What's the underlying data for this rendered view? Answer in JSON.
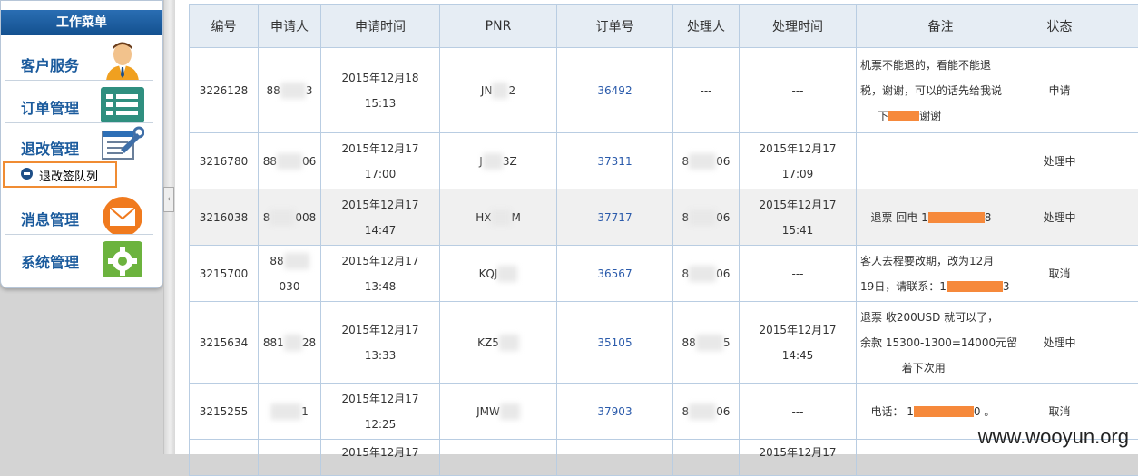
{
  "sidebar": {
    "title": "工作菜单",
    "items": [
      {
        "label": "客户服务",
        "icon": "customer-service-icon"
      },
      {
        "label": "订单管理",
        "icon": "order-list-icon"
      },
      {
        "label": "退改管理",
        "icon": "refund-tools-icon"
      },
      {
        "label": "消息管理",
        "icon": "mail-icon"
      },
      {
        "label": "系统管理",
        "icon": "settings-gear-icon"
      }
    ],
    "active_sub": {
      "label": "退改签队列",
      "icon": "minus-circle-icon"
    }
  },
  "splitter": {
    "glyph": "‹"
  },
  "table": {
    "headers": [
      "编号",
      "申请人",
      "申请时间",
      "PNR",
      "订单号",
      "处理人",
      "处理时间",
      "备注",
      "状态"
    ],
    "rows": [
      {
        "id": "3226128",
        "applicant_a": "88",
        "applicant_b": "3",
        "apply_time": [
          "2015年12月18",
          "15:13"
        ],
        "pnr_a": "JN",
        "pnr_b": "2",
        "order": "36492",
        "handler": "---",
        "handle_time": [
          "---"
        ],
        "remark": [
          "机票不能退的，看能不能退",
          "税，谢谢，可以的话先给我说",
          "下",
          "谢谢"
        ],
        "status": "申请"
      },
      {
        "id": "3216780",
        "applicant_a": "88",
        "applicant_b": "06",
        "apply_time": [
          "2015年12月17",
          "17:00"
        ],
        "pnr_a": "J",
        "pnr_b": "3Z",
        "order": "37311",
        "handler_a": "8",
        "handler_b": "06",
        "handle_time": [
          "2015年12月17",
          "17:09"
        ],
        "remark": [],
        "status": "处理中"
      },
      {
        "id": "3216038",
        "applicant_a": "8",
        "applicant_b": "008",
        "apply_time": [
          "2015年12月17",
          "14:47"
        ],
        "pnr_a": "HX",
        "pnr_b": "M",
        "order": "37717",
        "handler_a": "8",
        "handler_b": "06",
        "handle_time": [
          "2015年12月17",
          "15:41"
        ],
        "remark": [
          "退票 回电 1",
          "8"
        ],
        "status": "处理中"
      },
      {
        "id": "3215700",
        "applicant_a": "88",
        "applicant_b": "030",
        "apply_time": [
          "2015年12月17",
          "13:48"
        ],
        "pnr_a": "KQJ",
        "pnr_b": "",
        "order": "36567",
        "handler_a": "8",
        "handler_b": "06",
        "handle_time": [
          "---"
        ],
        "remark": [
          "客人去程要改期，改为12月",
          "19日，请联系：1",
          "3"
        ],
        "status": "取消"
      },
      {
        "id": "3215634",
        "applicant_a": "881",
        "applicant_b": "28",
        "apply_time": [
          "2015年12月17",
          "13:33"
        ],
        "pnr_a": "KZ5",
        "pnr_b": "",
        "order": "35105",
        "handler_a": "88",
        "handler_b": "5",
        "handle_time": [
          "2015年12月17",
          "14:45"
        ],
        "remark": [
          "退票 收200USD 就可以了，",
          "余款 15300-1300=14000元留",
          "着下次用"
        ],
        "status": "处理中"
      },
      {
        "id": "3215255",
        "applicant_a": "",
        "applicant_b": "1",
        "apply_time": [
          "2015年12月17",
          "12:25"
        ],
        "pnr_a": "JMW",
        "pnr_b": "",
        "order": "37903",
        "handler_a": "8",
        "handler_b": "06",
        "handle_time": [
          "---"
        ],
        "remark": [
          "电话： 1",
          "0 。"
        ],
        "status": "取消"
      },
      {
        "id": "",
        "applicant_a": "",
        "applicant_b": "",
        "apply_time": [
          "2015年12月17",
          ""
        ],
        "pnr_a": "",
        "pnr_b": "",
        "order": "",
        "handler_a": "",
        "handler_b": "",
        "handle_time": [
          "2015年12月17"
        ],
        "remark": [],
        "status": ""
      }
    ]
  },
  "watermark": "www.wooyun.org",
  "colors": {
    "accent": "#1a5a9c",
    "highlight": "#f08c33",
    "redaction": "#f6893b",
    "link": "#2b5bab"
  }
}
